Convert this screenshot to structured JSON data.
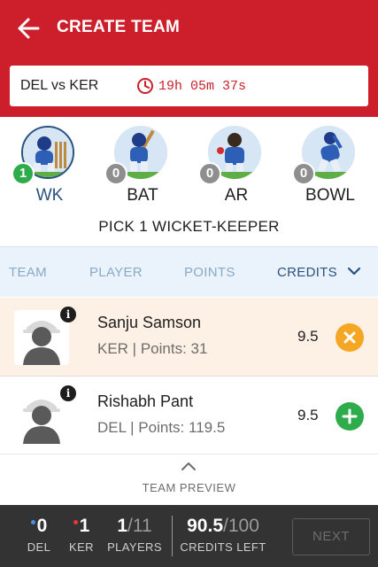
{
  "header": {
    "title": "CREATE TEAM",
    "match": "DEL vs KER",
    "timer": "19h 05m 37s",
    "color": "#cc1f2b"
  },
  "roles": [
    {
      "label": "WK",
      "count": "1",
      "selected": true
    },
    {
      "label": "BAT",
      "count": "0",
      "selected": false
    },
    {
      "label": "AR",
      "count": "0",
      "selected": false
    },
    {
      "label": "BOWL",
      "count": "0",
      "selected": false
    }
  ],
  "instruction": "PICK 1 WICKET-KEEPER",
  "sort": {
    "team": "TEAM",
    "player": "PLAYER",
    "points": "POINTS",
    "credits": "CREDITS"
  },
  "players": [
    {
      "name": "Sanju Samson",
      "meta": "KER | Points: 31",
      "credits": "9.5",
      "selected": true,
      "action": "remove"
    },
    {
      "name": "Rishabh Pant",
      "meta": "DEL | Points: 119.5",
      "credits": "9.5",
      "selected": false,
      "action": "add"
    }
  ],
  "preview": {
    "label": "TEAM PREVIEW"
  },
  "footer": {
    "del": {
      "value": "0",
      "label": "DEL",
      "dot_color": "#4a90e2"
    },
    "ker": {
      "value": "1",
      "label": "KER",
      "dot_color": "#e53935"
    },
    "players": {
      "value": "1",
      "total": "/11",
      "label": "PLAYERS"
    },
    "credits": {
      "value": "90.5",
      "total": "/100",
      "label": "CREDITS LEFT"
    },
    "next": "NEXT"
  }
}
